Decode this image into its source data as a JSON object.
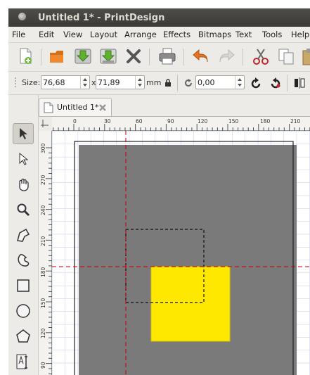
{
  "window": {
    "title": "Untitled 1* - PrintDesign"
  },
  "menu": [
    "File",
    "Edit",
    "View",
    "Layout",
    "Arrange",
    "Effects",
    "Bitmaps",
    "Text",
    "Tools",
    "Help"
  ],
  "toolbar": {
    "buttons": [
      "new-document",
      "open",
      "save",
      "save-as",
      "close",
      "print",
      "undo",
      "redo",
      "cut",
      "copy",
      "paste"
    ]
  },
  "properties": {
    "size_label": "Size:",
    "width_value": "76,68",
    "times": "x",
    "height_value": "71,89",
    "unit": "mm",
    "rotation_value": "0,00"
  },
  "tools": [
    "select",
    "node-edit",
    "fleur",
    "zoom",
    "polyline",
    "curve",
    "rectangle",
    "ellipse",
    "polygon",
    "text"
  ],
  "tab": {
    "label": "Untitled 1*"
  },
  "ruler": {
    "unit": "mm",
    "h_ticks": [
      "0",
      "30",
      "60",
      "90",
      "120",
      "150",
      "180",
      "210"
    ],
    "v_ticks": [
      "300",
      "270",
      "240",
      "210",
      "180",
      "150",
      "120",
      "90"
    ]
  },
  "colors": {
    "selection_fill": "#ffe800",
    "guide": "#cc0000",
    "grid": "#c9c9f0",
    "titlebar": "#3f3e3a"
  }
}
